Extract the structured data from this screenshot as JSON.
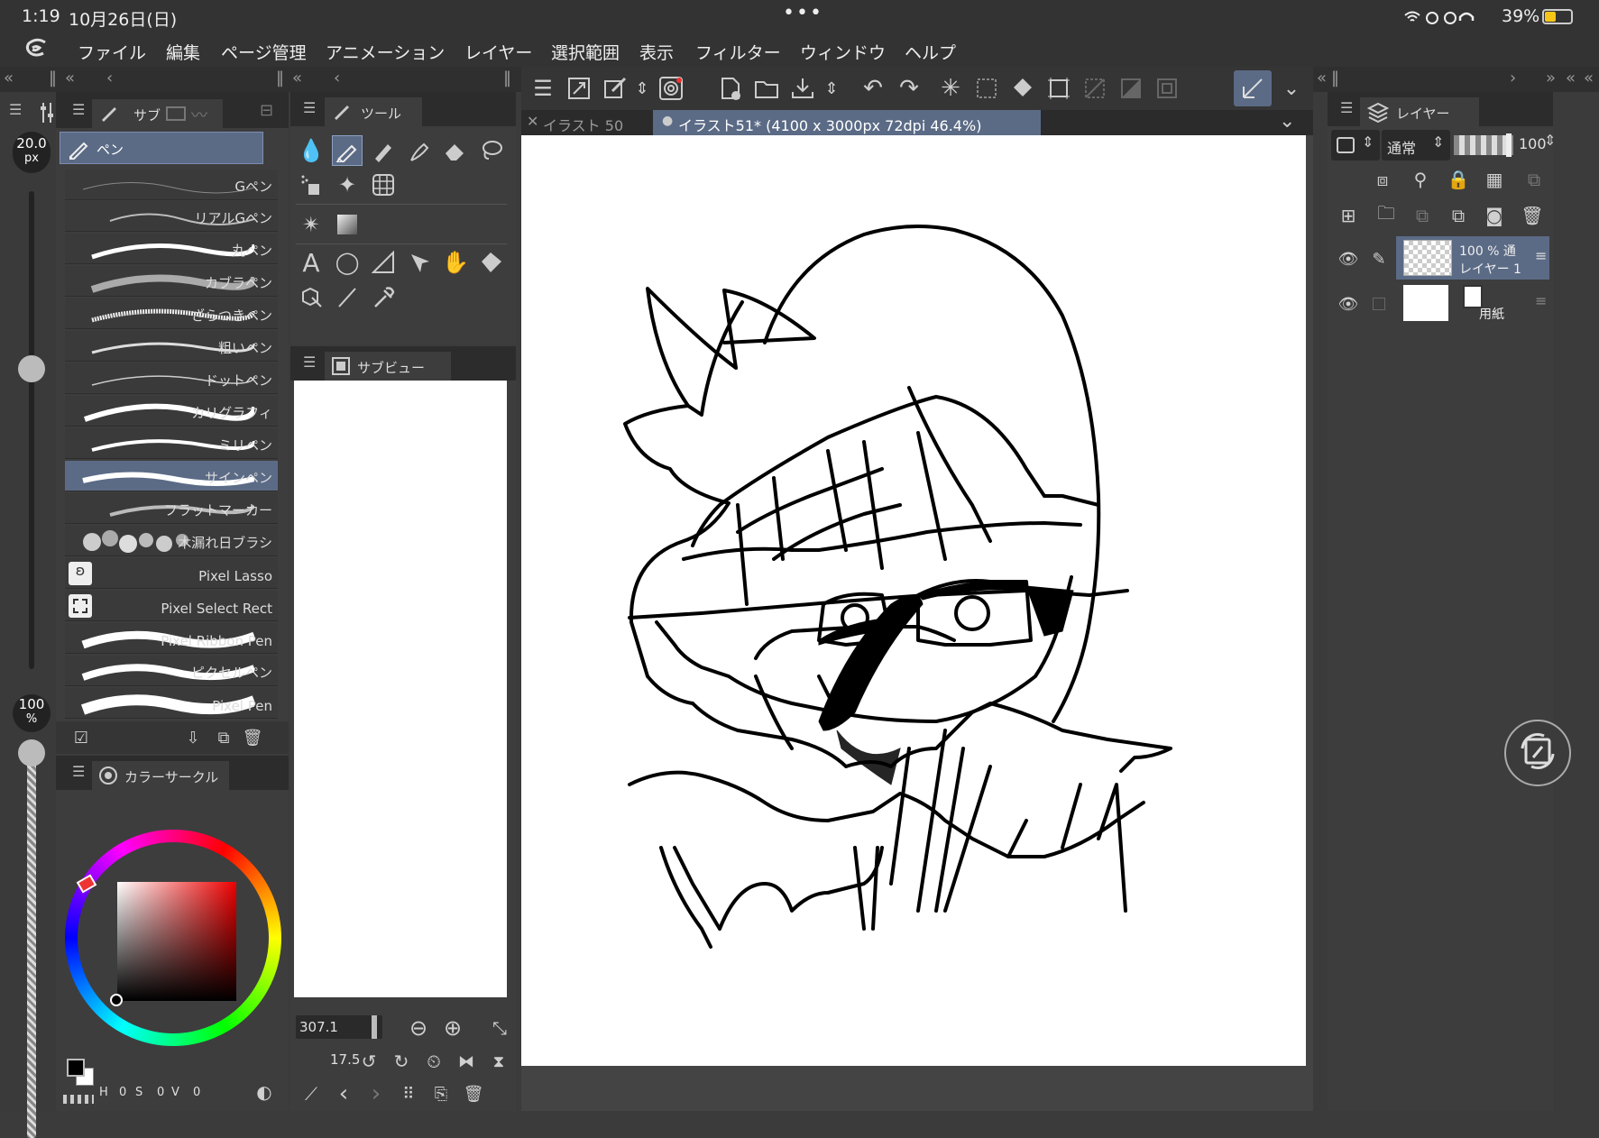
{
  "status": {
    "time": "1:19",
    "date": "10月26日(日)",
    "battery": "39%"
  },
  "menu": [
    "ファイル",
    "編集",
    "ページ管理",
    "アニメーション",
    "レイヤー",
    "選択範囲",
    "表示",
    "フィルター",
    "ウィンドウ",
    "ヘルプ"
  ],
  "brush_size": {
    "value": "20.0",
    "unit": "px"
  },
  "opacity": {
    "value": "100",
    "unit": "%"
  },
  "subtool_panel": {
    "tab_label": "サブ",
    "group_label": "ペン"
  },
  "brushes": [
    "Gペン",
    "リアルGペン",
    "丸ペン",
    "カブラペン",
    "ざらつきペン",
    "粗いペン",
    "ドットペン",
    "カリグラフィ",
    "ミリペン",
    "サインペン",
    "フラットマーカー",
    "木漏れ日ブラシ",
    "Pixel Lasso",
    "Pixel Select Rect",
    "Pixel Ribbon Pen",
    "ピクセルペン",
    "Pixel Pen"
  ],
  "selected_brush": "サインペン",
  "tool_panel": {
    "tab_label": "ツール"
  },
  "subview": {
    "tab_label": "サブビュー"
  },
  "color_panel": {
    "tab_label": "カラーサークル",
    "h_label": "H",
    "h": "0",
    "s_label": "S",
    "s": "0",
    "v_label": "V",
    "v": "0"
  },
  "navigator": {
    "zoom": "307.1",
    "rotation": "17.5"
  },
  "canvas_tabs": [
    {
      "label": "イラスト 50",
      "active": false
    },
    {
      "label": "イラスト51* (4100 x 3000px 72dpi 46.4%)",
      "active": true
    }
  ],
  "layer_panel": {
    "tab_label": "レイヤー",
    "blend_mode": "通常",
    "opacity_value": "100",
    "layers": [
      {
        "name": "レイヤー 1",
        "info": "100 % 通",
        "selected": true
      },
      {
        "name": "用紙",
        "info": "",
        "selected": false
      }
    ]
  },
  "colors": {
    "accent": "#5b6b86",
    "panel": "#3d3d3d",
    "canvas": "#ffffff"
  }
}
